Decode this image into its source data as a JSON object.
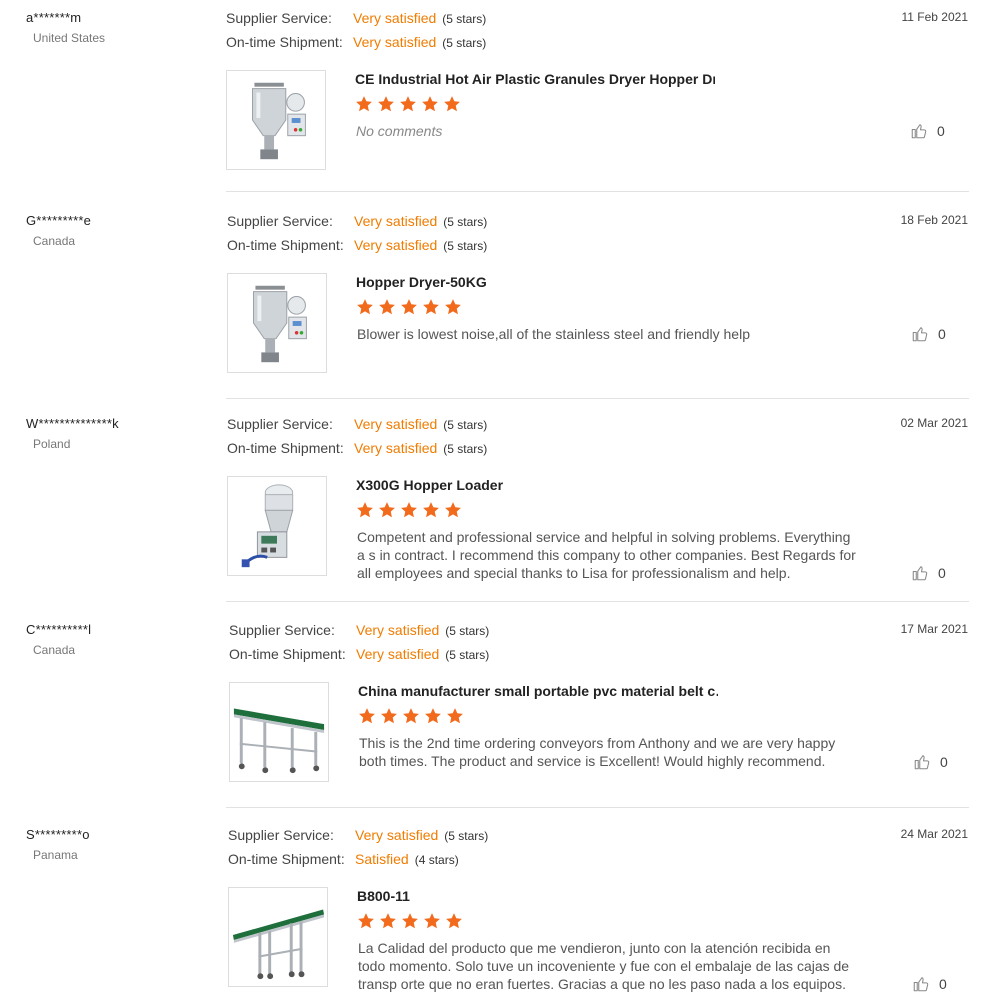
{
  "labels": {
    "supplier_service": "Supplier Service:",
    "ontime_shipment": "On-time Shipment:"
  },
  "colors": {
    "accent": "#f07c00",
    "star": "#f26b1d"
  },
  "reviews": [
    {
      "user": "a*******m",
      "country": "United States",
      "date": "11 Feb 2021",
      "supplier_value": "Very satisfied",
      "supplier_stars": "(5 stars)",
      "shipment_value": "Very satisfied",
      "shipment_stars": "(5 stars)",
      "product_title": "CE Industrial Hot Air Plastic Granules Dryer Hopper Dr…",
      "product_icon": "hopper-dryer-image",
      "rating": 5,
      "comment": "No comments",
      "likes": "0"
    },
    {
      "user": "G*********e",
      "country": "Canada",
      "date": "18 Feb 2021",
      "supplier_value": "Very satisfied",
      "supplier_stars": "(5 stars)",
      "shipment_value": "Very satisfied",
      "shipment_stars": "(5 stars)",
      "product_title": "Hopper Dryer-50KG",
      "product_icon": "hopper-dryer-image",
      "rating": 5,
      "comment": "Blower is lowest noise,all of the stainless steel and friendly help",
      "likes": "0"
    },
    {
      "user": "W**************k",
      "country": "Poland",
      "date": "02 Mar 2021",
      "supplier_value": "Very satisfied",
      "supplier_stars": "(5 stars)",
      "shipment_value": "Very satisfied",
      "shipment_stars": "(5 stars)",
      "product_title": "X300G Hopper Loader",
      "product_icon": "hopper-loader-image",
      "rating": 5,
      "comment": "Competent and professional service and helpful in solving problems. Everything a s in contract. I recommend this company to other companies. Best Regards for all employees and special thanks to Lisa for professionalism and help.",
      "likes": "0"
    },
    {
      "user": "C**********l",
      "country": "Canada",
      "date": "17 Mar 2021",
      "supplier_value": "Very satisfied",
      "supplier_stars": "(5 stars)",
      "shipment_value": "Very satisfied",
      "shipment_stars": "(5 stars)",
      "product_title": "China manufacturer small portable pvc material belt c…",
      "product_icon": "belt-conveyor-image",
      "rating": 5,
      "comment": "This is the 2nd time ordering conveyors from Anthony and we are very happy both times.  The product and service is Excellent!  Would highly recommend.",
      "likes": "0"
    },
    {
      "user": "S*********o",
      "country": "Panama",
      "date": "24 Mar 2021",
      "supplier_value": "Very satisfied",
      "supplier_stars": "(5 stars)",
      "shipment_value": "Satisfied",
      "shipment_stars": "(4 stars)",
      "product_title": "B800-11",
      "product_icon": "incline-conveyor-image",
      "rating": 5,
      "comment": "La Calidad del producto que me vendieron, junto con la atención recibida en todo momento. Solo tuve un incoveniente y fue con el embalaje de las cajas de transp orte que no eran fuertes. Gracias a que no les paso nada a los equipos.",
      "likes": "0"
    }
  ]
}
